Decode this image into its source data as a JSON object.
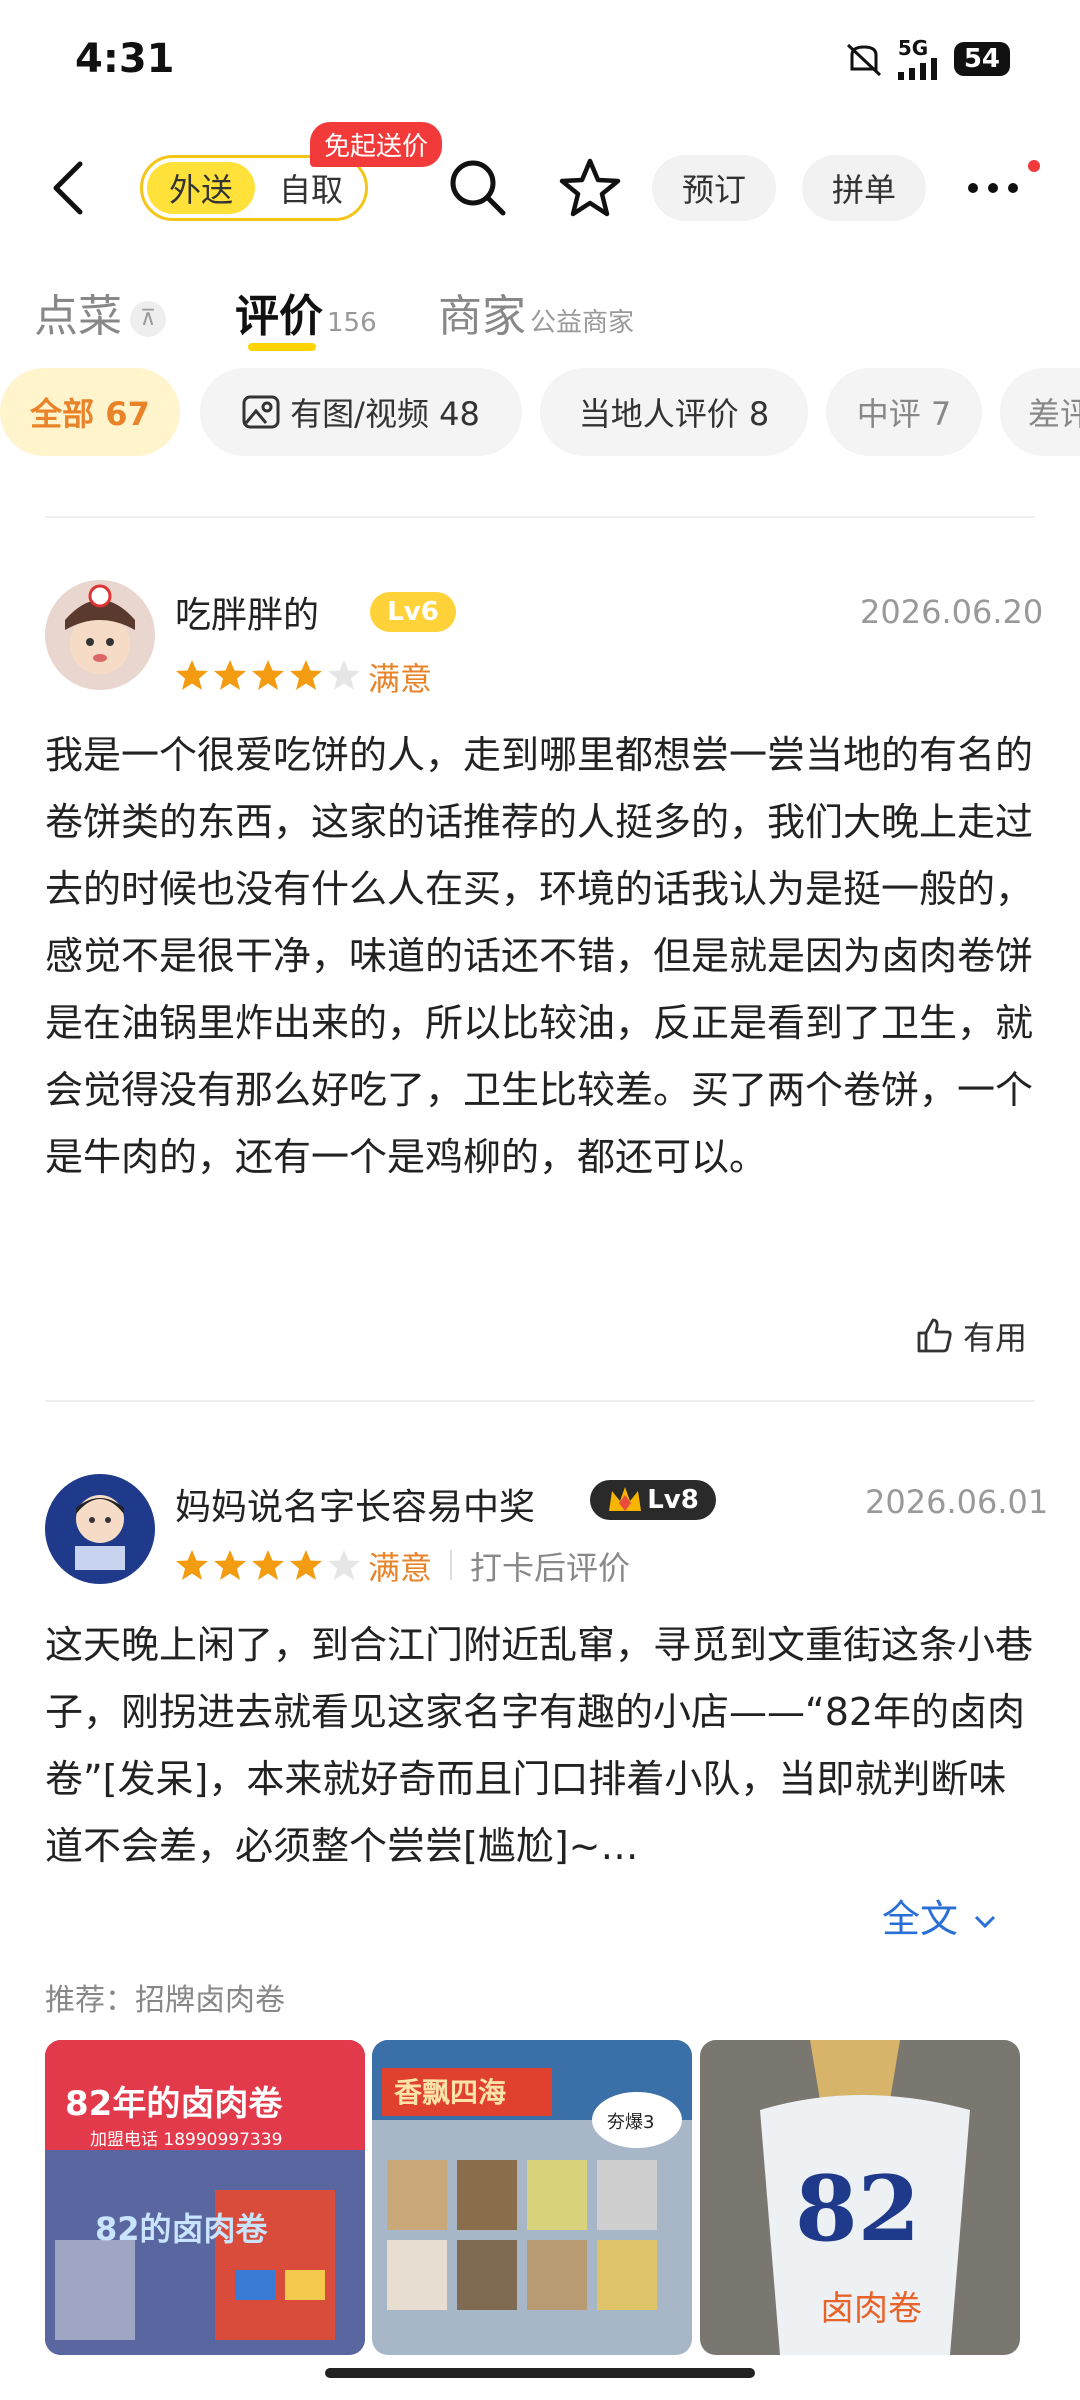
{
  "status": {
    "time": "4:31",
    "network": "5G",
    "battery": "54"
  },
  "nav": {
    "delivery": "外送",
    "pickup": "自取",
    "promo": "免起送价",
    "reserve": "预订",
    "group": "拼单"
  },
  "tabs": [
    {
      "label": "点菜",
      "sub": ""
    },
    {
      "label": "评价",
      "sub": "156"
    },
    {
      "label": "商家",
      "sub": "公益商家"
    }
  ],
  "filters": [
    {
      "label": "全部 67"
    },
    {
      "label": "有图/视频 48"
    },
    {
      "label": "当地人评价 8"
    },
    {
      "label": "中评 7"
    },
    {
      "label": "差评"
    }
  ],
  "reviews": [
    {
      "user": "吃胖胖的",
      "level": "Lv6",
      "date": "2026.06.20",
      "rating": 4,
      "rating_label": "满意",
      "text": "我是一个很爱吃饼的人，走到哪里都想尝一尝当地的有名的卷饼类的东西，这家的话推荐的人挺多的，我们大晚上走过去的时候也没有什么人在买，环境的话我认为是挺一般的，感觉不是很干净，味道的话还不错，但是就是因为卤肉卷饼是在油锅里炸出来的，所以比较油，反正是看到了卫生，就会觉得没有那么好吃了，卫生比较差。买了两个卷饼，一个是牛肉的，还有一个是鸡柳的，都还可以。",
      "helpful": "有用"
    },
    {
      "user": "妈妈说名字长容易中奖",
      "level": "Lv8",
      "date": "2026.06.01",
      "rating": 4,
      "rating_label": "满意",
      "note": "打卡后评价",
      "text": "这天晚上闲了，到合江门附近乱窜，寻觅到文重街这条小巷子，刚拐进去就看见这家名字有趣的小店——“82年的卤肉卷”[发呆]，本来就好奇而且门口排着小队，当即就判断味道不会差，必须整个尝尝[尴尬]~…",
      "expand": "全文",
      "recommend": "推荐：招牌卤肉卷",
      "photos": [
        {
          "sign_top": "82年的卤肉卷",
          "phone": "加盟电话 18990997339",
          "sign_bottom": "82的卤肉卷"
        },
        {
          "sign_top": "香飘四海",
          "tag": "夯爆3"
        },
        {
          "cup_text": "82",
          "cup_sub": "卤肉卷"
        }
      ]
    }
  ]
}
